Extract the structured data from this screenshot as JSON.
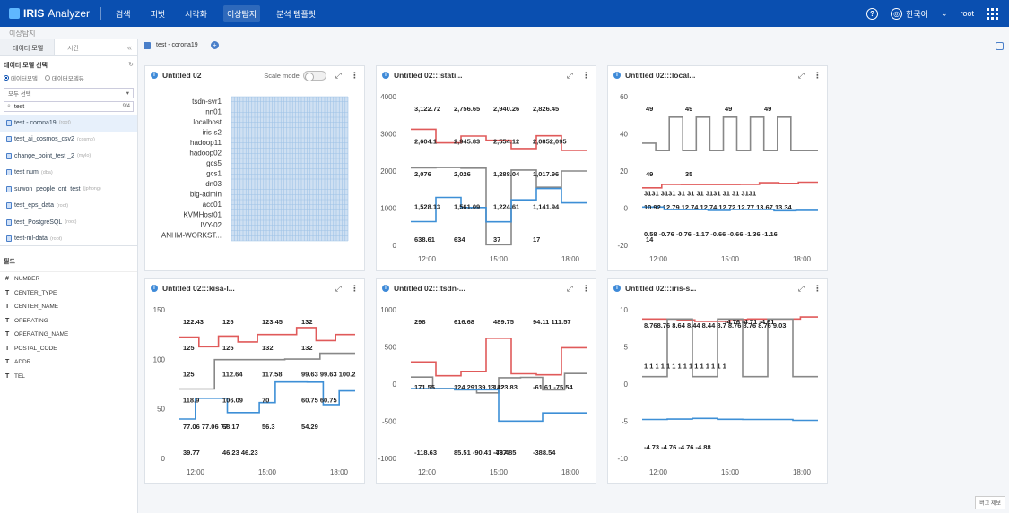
{
  "app": {
    "logo_main": "IRIS",
    "logo_sub": "Analyzer"
  },
  "nav": [
    {
      "label": "검색",
      "active": false
    },
    {
      "label": "피벗",
      "active": false
    },
    {
      "label": "시각화",
      "active": false
    },
    {
      "label": "이상탐지",
      "active": true
    },
    {
      "label": "분석 템플릿",
      "active": false
    }
  ],
  "topright": {
    "help": "?",
    "language": "한국어",
    "user": "root"
  },
  "breadcrumb": "이상탐지",
  "sidebar": {
    "tabs": [
      "데이터 모델",
      "시간"
    ],
    "collapse": "«",
    "section_title": "데이터 모델 선택",
    "radios": [
      "데이터모델",
      "데이터모델뷰"
    ],
    "select_value": "모두 선택",
    "search_value": "test",
    "search_count": "9/4",
    "models": [
      {
        "name": "test - corona19",
        "tag": "(root)",
        "active": true
      },
      {
        "name": "test_ai_cosmos_csv2",
        "tag": "(cosmo)"
      },
      {
        "name": "change_point_test _2",
        "tag": "(mylo)"
      },
      {
        "name": "test num",
        "tag": "(dba)"
      },
      {
        "name": "suwon_people_cnt_test",
        "tag": "(jphong)"
      },
      {
        "name": "test_eps_data",
        "tag": "(root)"
      },
      {
        "name": "test_PostgreSQL",
        "tag": "(root)"
      },
      {
        "name": "test-ml-data",
        "tag": "(root)"
      }
    ],
    "fields_title": "필드",
    "fields": [
      {
        "type": "#",
        "name": "NUMBER"
      },
      {
        "type": "T",
        "name": "CENTER_TYPE"
      },
      {
        "type": "T",
        "name": "CENTER_NAME"
      },
      {
        "type": "T",
        "name": "OPERATING"
      },
      {
        "type": "T",
        "name": "OPERATING_NAME"
      },
      {
        "type": "T",
        "name": "POSTAL_CODE"
      },
      {
        "type": "T",
        "name": "ADDR"
      },
      {
        "type": "T",
        "name": "TEL"
      }
    ]
  },
  "tab": {
    "label": "test - corona19"
  },
  "bug_button": "버그 제보",
  "panels": [
    {
      "title": "Untitled 02",
      "scale_label": "Scale mode"
    },
    {
      "title": "Untitled 02:::stati..."
    },
    {
      "title": "Untitled 02:::local..."
    },
    {
      "title": "Untitled 02:::kisa-l..."
    },
    {
      "title": "Untitled 02:::tsdn-..."
    },
    {
      "title": "Untitled 02:::iris-s..."
    }
  ],
  "chart_data": [
    {
      "type": "heatmap",
      "categories": [
        "tsdn-svr1",
        "nn01",
        "localhost",
        "iris-s2",
        "hadoop11",
        "hadoop02",
        "gcs5",
        "gcs1",
        "dn03",
        "big-admin",
        "acc01",
        "KVMHost01",
        "IVY-02",
        "ANHM-WORKST..."
      ],
      "colors": {
        "cell": "#cfe0f2",
        "grid": "#9ec2e6"
      }
    },
    {
      "type": "line",
      "x": [
        "12:00",
        "15:00",
        "18:00"
      ],
      "ylim": [
        0,
        4000
      ],
      "yticks": [
        0,
        1000,
        2000,
        3000,
        4000
      ],
      "series": [
        {
          "color": "#e05a5a",
          "values": [
            3122.72,
            2756.65,
            2940.26,
            2826.45,
            2604.1,
            2945.83,
            2554.12
          ]
        },
        {
          "color": "#888888",
          "values": [
            2085,
            2095,
            2076,
            17,
            2026,
            1561.09,
            2000
          ]
        },
        {
          "color": "#3d8fd6",
          "values": [
            638.61,
            1288.04,
            1017.96,
            634,
            1224.61,
            1528.13,
            1141.94
          ]
        }
      ],
      "labels": [
        "3,122.72",
        "2,756.65",
        "2,940.26",
        "2,826.45",
        "2,604.1",
        "2,945.83",
        "2,554.12",
        "2,0852,095",
        "2,076",
        "2,026",
        "1,288.04",
        "1,017.96",
        "1,528.13",
        "1,561.09",
        "1,224.61",
        "1,141.94",
        "638.61",
        "634",
        "37",
        "17"
      ]
    },
    {
      "type": "line",
      "x": [
        "12:00",
        "15:00",
        "18:00"
      ],
      "ylim": [
        -20,
        60
      ],
      "yticks": [
        -20,
        0,
        20,
        40,
        60
      ],
      "series": [
        {
          "color": "#888888",
          "values": [
            35,
            31,
            49,
            31,
            49,
            31,
            49,
            31,
            49,
            31,
            49,
            31,
            31
          ]
        },
        {
          "color": "#e05a5a",
          "values": [
            10.92,
            12.79,
            12.74,
            12.74,
            12.72,
            12.77,
            13.67,
            13.34,
            14
          ]
        },
        {
          "color": "#3d8fd6",
          "values": [
            0.58,
            -0.76,
            -0.76,
            -1.17,
            -0.66,
            -0.66,
            -1.36,
            -1.16
          ]
        }
      ],
      "labels": [
        "49",
        "49",
        "49",
        "49",
        "49",
        "35",
        "3131 3131  31  31  31  3131  31  31  3131",
        "10.92 12.79 12.74 12.74 12.72 12.77 13.67 13.34",
        "14",
        "0.58  -0.76  -0.76  -1.17  -0.66  -0.66  -1.36  -1.16"
      ]
    },
    {
      "type": "line",
      "x": [
        "12:00",
        "15:00",
        "18:00"
      ],
      "ylim": [
        0,
        150
      ],
      "yticks": [
        0,
        50,
        100,
        150
      ],
      "series": [
        {
          "color": "#e05a5a",
          "values": [
            122.43,
            112.64,
            123.45,
            117.58,
            125,
            125,
            132,
            118.9,
            125
          ]
        },
        {
          "color": "#888888",
          "values": [
            70,
            99.63,
            99.63,
            100.2,
            106.09
          ]
        },
        {
          "color": "#3d8fd6",
          "values": [
            39.77,
            60.75,
            60.75,
            46.23,
            46.23,
            56.3,
            77.06,
            77.06,
            77,
            54.29,
            68.17
          ]
        }
      ],
      "labels": [
        "122.43",
        "125",
        "123.45",
        "132",
        "125",
        "125",
        "132",
        "132",
        "125",
        "112.64",
        "117.58",
        "99.63 99.63 100.2",
        "118.9",
        "106.09",
        "70",
        "60.75 60.75",
        "77.06 77.06 77",
        "68.17",
        "56.3",
        "54.29",
        "39.77",
        "46.23 46.23"
      ]
    },
    {
      "type": "line",
      "x": [
        "12:00",
        "15:00",
        "18:00"
      ],
      "ylim": [
        -1000,
        1000
      ],
      "yticks": [
        -1000,
        -500,
        0,
        500,
        1000
      ],
      "series": [
        {
          "color": "#e05a5a",
          "values": [
            298,
            111.57,
            171.55,
            616.68,
            139.13,
            123.83,
            489.75
          ]
        },
        {
          "color": "#888888",
          "values": [
            94.11,
            -61.61,
            -75.54,
            -118.63,
            85.51,
            90.41,
            -78.4,
            142
          ]
        },
        {
          "color": "#3d8fd6",
          "values": [
            -61.61,
            -75.54,
            -497.85,
            -388.54
          ]
        }
      ],
      "labels": [
        "298",
        "616.68",
        "489.75",
        "94.11 111.57",
        "171.55",
        "124.29139.13 123.83",
        "142",
        "-61.61 -75.54",
        "-118.63",
        "85.51 -90.41 -78.4",
        "-497.85",
        "-388.54"
      ]
    },
    {
      "type": "line",
      "x": [
        "12:00",
        "15:00",
        "18:00"
      ],
      "ylim": [
        -10,
        10
      ],
      "yticks": [
        -10,
        -5,
        0,
        5,
        10
      ],
      "series": [
        {
          "color": "#e05a5a",
          "values": [
            8.76,
            8.76,
            8.64,
            8.44,
            8.44,
            8.7,
            8.76,
            8.76,
            8.76,
            9.03
          ]
        },
        {
          "color": "#888888",
          "values": [
            1,
            8.76,
            1,
            8.76,
            1,
            8.76,
            1
          ]
        },
        {
          "color": "#3d8fd6",
          "values": [
            -4.76,
            -4.71,
            -4.61,
            -4.73,
            -4.76,
            -4.76,
            -4.88
          ]
        }
      ],
      "labels": [
        "8.768.76 8.64 8.44 8.44 8.7 8.76 8.76 8.76 9.03",
        "1 1 1 1 1 1 1 1 1 1 1 1 1 1 1",
        "-4.76 -4.71 -4.61",
        "-4.73 -4.76 -4.76 -4.88"
      ]
    }
  ]
}
